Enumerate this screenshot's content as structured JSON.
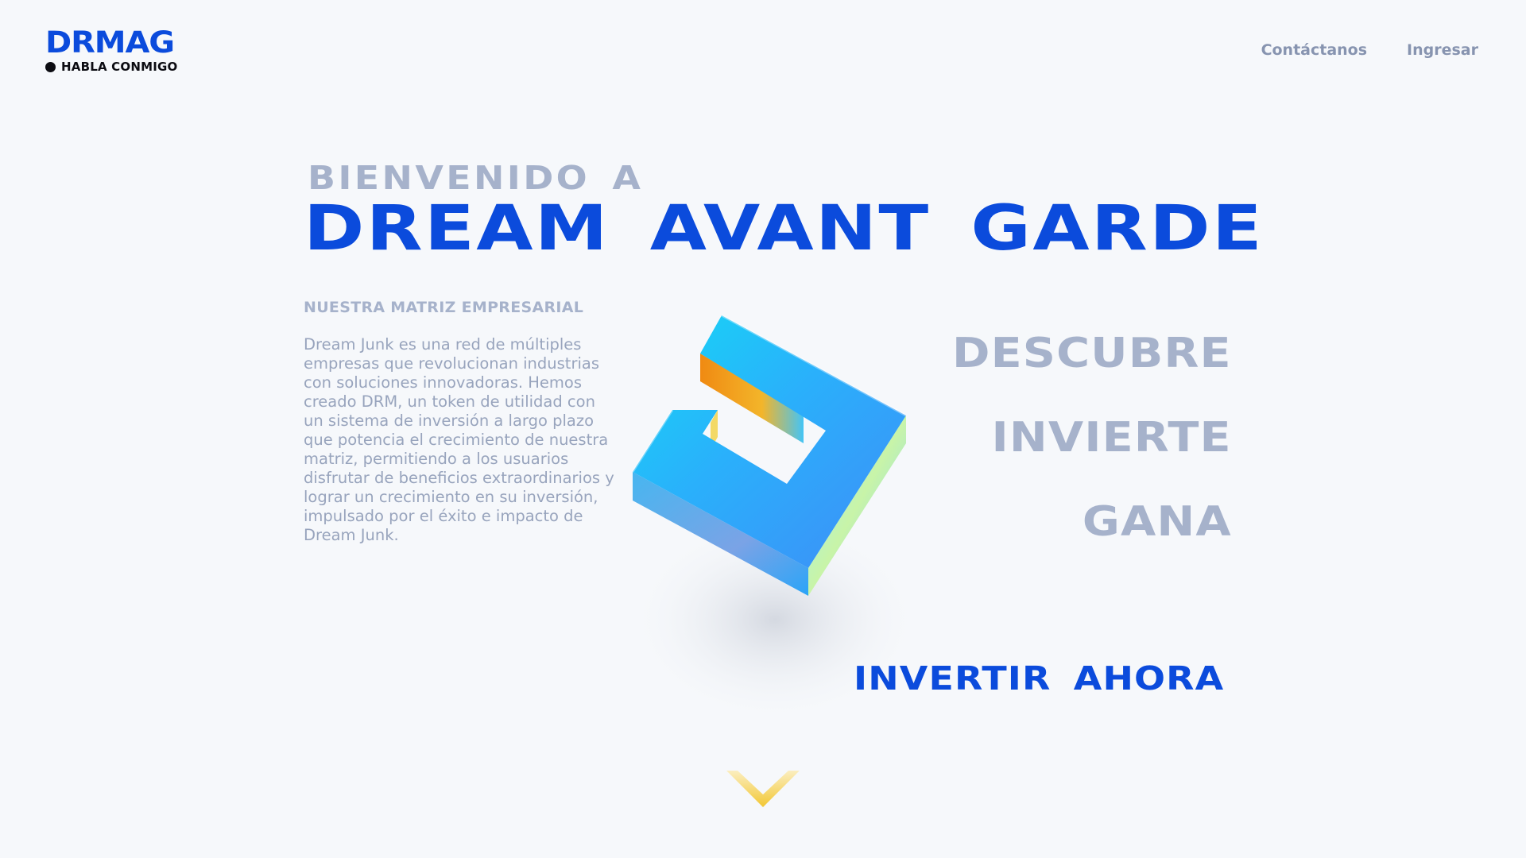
{
  "header": {
    "logo": "DRMAG",
    "tagline": "HABLA CONMIGO",
    "nav": [
      {
        "label": "Contáctanos"
      },
      {
        "label": "Ingresar"
      }
    ]
  },
  "hero": {
    "welcome": "BIENVENIDO A",
    "title": "DREAM AVANT GARDE",
    "section_label": "NUESTRA MATRIZ EMPRESARIAL",
    "description": "Dream Junk es una red de múltiples empresas que revolucionan industrias con soluciones innovadoras. Hemos creado DRM, un token de utilidad con un sistema de inversión a largo plazo que potencia el crecimiento de nuestra matriz, permitiendo a los usuarios disfrutar de beneficios extraordinarios y lograr un crecimiento en su inversión, impulsado por el éxito e impacto de Dream Junk.",
    "words": [
      "DESCUBRE",
      "INVIERTE",
      "GANA"
    ],
    "cta": "INVERTIR AHORA"
  },
  "icons": {
    "hero_art": "3d-square-logo-icon",
    "scroll": "chevron-down-icon"
  },
  "colors": {
    "brand_blue": "#0b4bdc",
    "muted": "#a6b2cb",
    "background": "#f6f8fb",
    "accent_yellow": "#f5cf4a"
  }
}
